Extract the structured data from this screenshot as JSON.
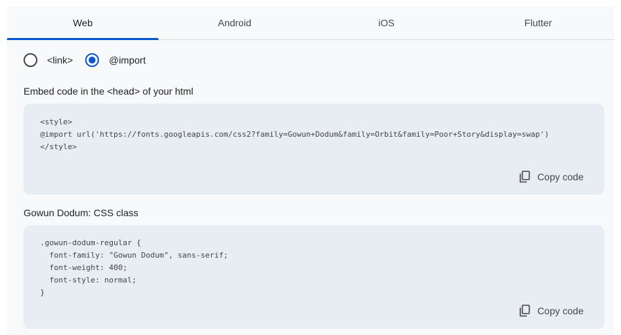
{
  "tabs": [
    {
      "label": "Web",
      "active": true
    },
    {
      "label": "Android",
      "active": false
    },
    {
      "label": "iOS",
      "active": false
    },
    {
      "label": "Flutter",
      "active": false
    }
  ],
  "embed_type": {
    "options": [
      {
        "label": "<link>",
        "selected": false
      },
      {
        "label": "@import",
        "selected": true
      }
    ]
  },
  "embed_section": {
    "label": "Embed code in the <head> of your html",
    "code": "<style>\n@import url('https://fonts.googleapis.com/css2?family=Gowun+Dodum&family=Orbit&family=Poor+Story&display=swap')\n</style>",
    "copy_label": "Copy code"
  },
  "css_section": {
    "label": "Gowun Dodum: CSS class",
    "code": ".gowun-dodum-regular {\n  font-family: \"Gowun Dodum\", sans-serif;\n  font-weight: 400;\n  font-style: normal;\n}",
    "copy_label": "Copy code"
  },
  "colors": {
    "accent": "#0b57d0",
    "code_background": "#e8ecf3",
    "panel_background": "#f8f9fb"
  }
}
